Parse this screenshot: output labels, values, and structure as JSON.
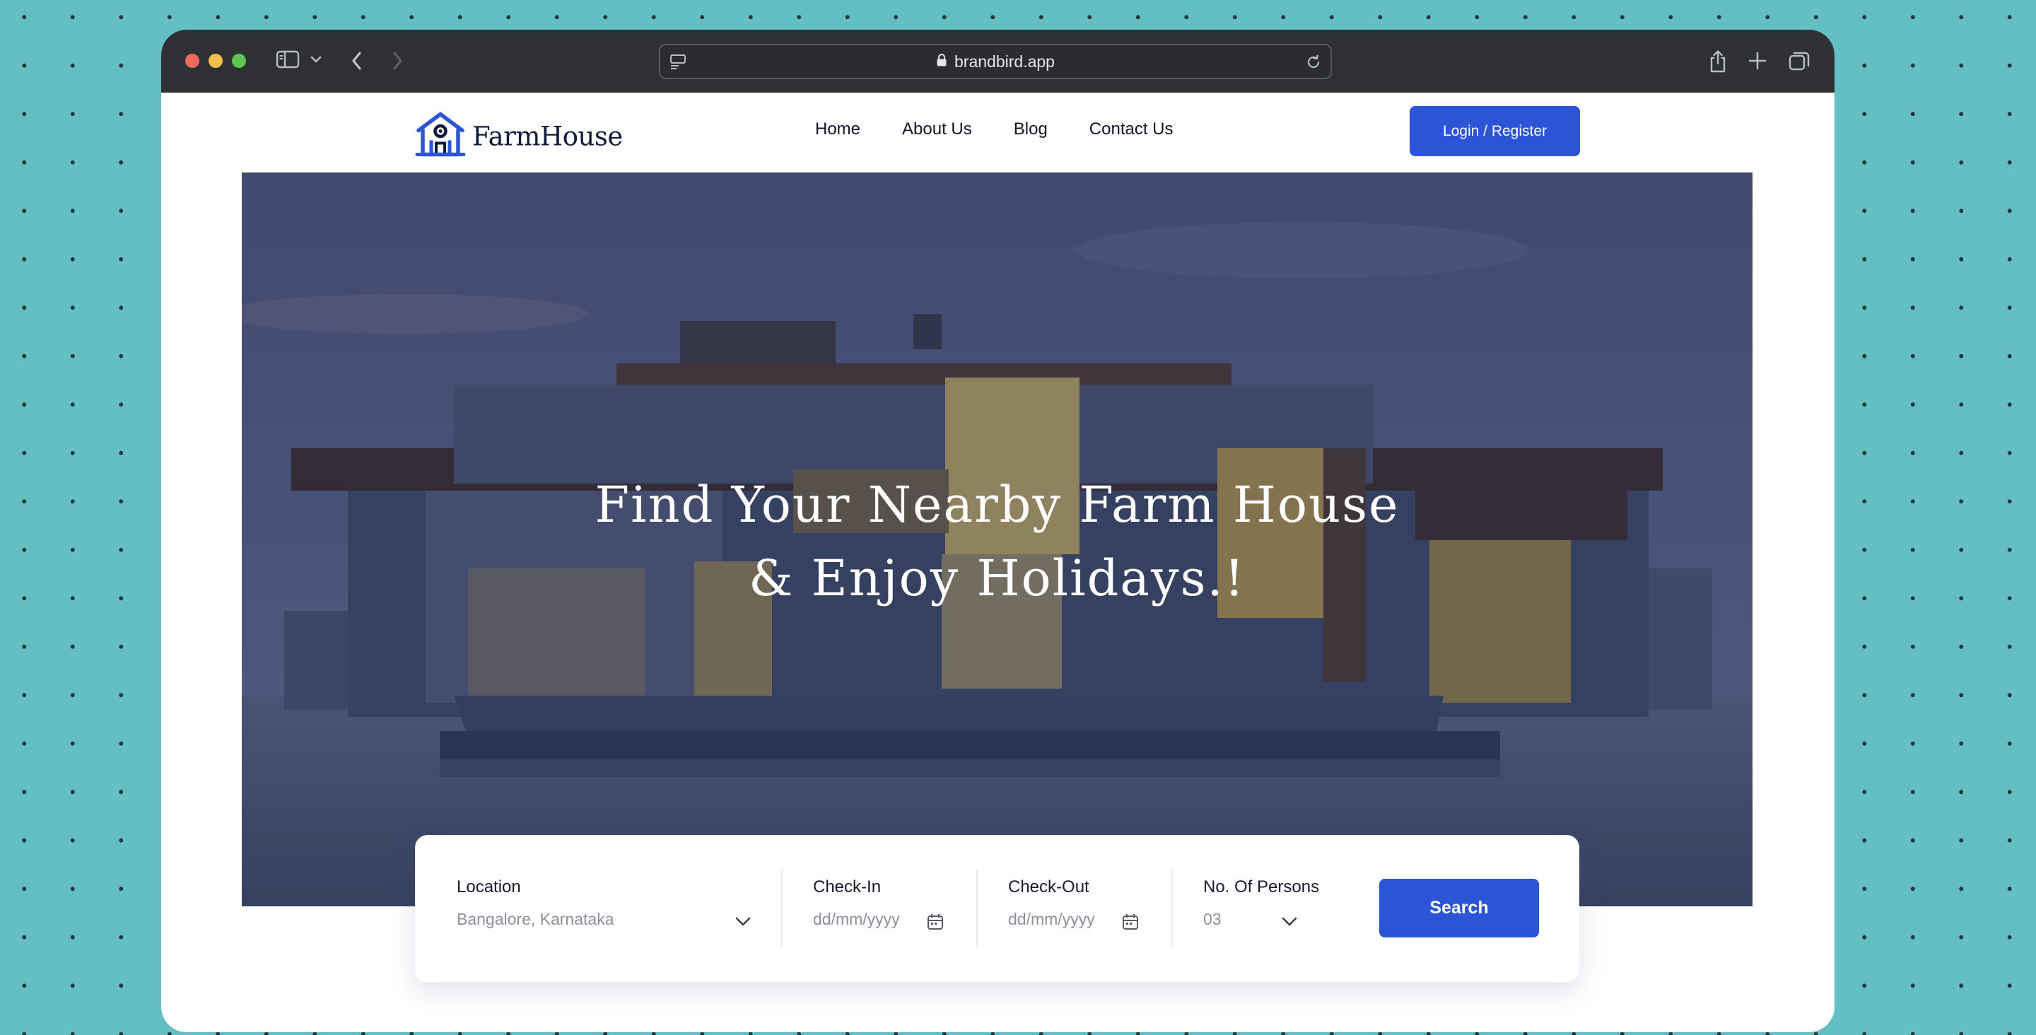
{
  "browser": {
    "url": "brandbird.app"
  },
  "site": {
    "brand": "FarmHouse",
    "nav": [
      "Home",
      "About Us",
      "Blog",
      "Contact Us"
    ],
    "login_label": "Login / Register"
  },
  "hero": {
    "title_line1": "Find Your Nearby Farm House",
    "title_line2": "& Enjoy Holidays.!"
  },
  "search": {
    "location": {
      "label": "Location",
      "value": "Bangalore, Karnataka"
    },
    "checkin": {
      "label": "Check-In",
      "placeholder": "dd/mm/yyyy"
    },
    "checkout": {
      "label": "Check-Out",
      "placeholder": "dd/mm/yyyy"
    },
    "persons": {
      "label": "No. Of Persons",
      "value": "03"
    },
    "button_label": "Search"
  },
  "colors": {
    "accent": "#2c54d6",
    "page_background": "#63bfc3",
    "browser_chrome": "#2e3034"
  },
  "icons": [
    "sidebar-icon",
    "chevron-down-icon",
    "back-arrow-icon",
    "forward-arrow-icon",
    "site-settings-icon",
    "lock-icon",
    "reload-icon",
    "share-icon",
    "plus-icon",
    "tabs-icon",
    "house-logo-icon",
    "calendar-icon"
  ]
}
